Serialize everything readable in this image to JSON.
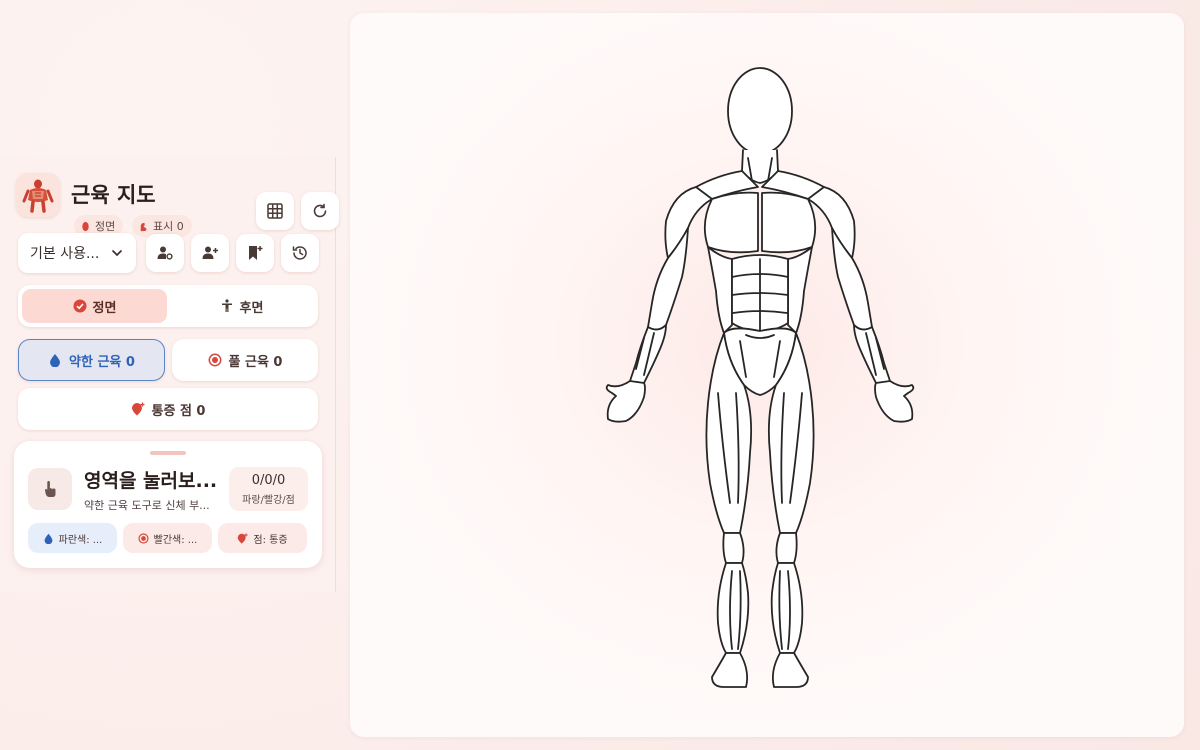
{
  "app": {
    "title": "근육 지도",
    "view_chip": "정면",
    "mark_chip": "표시 0"
  },
  "header_buttons": {
    "grid_icon": "grid-icon",
    "refresh_icon": "refresh-icon"
  },
  "profile": {
    "selected": "기본 사용..."
  },
  "tools": [
    "user-gear-icon",
    "user-plus-icon",
    "bookmark-plus-icon",
    "history-icon"
  ],
  "view_toggle": {
    "front": "정면",
    "back": "후면",
    "active": "front"
  },
  "modes": {
    "weak": "약한 근육 0",
    "tight": "풀 근육 0",
    "pain": "통증 점 0",
    "active": "weak"
  },
  "info_card": {
    "title": "영역을 눌러보...",
    "subtitle": "약한 근육 도구로 신체 부...",
    "count_value": "0/0/0",
    "count_label": "파랑/빨강/점",
    "legend": {
      "blue": "파란색: ...",
      "red": "빨간색: ...",
      "pain": "점: 통증"
    }
  },
  "colors": {
    "accent": "#d9473c",
    "weak_blue": "#2f63b8",
    "panel_bg": "#fdf1ef",
    "canvas_bg": "#fffafa"
  }
}
